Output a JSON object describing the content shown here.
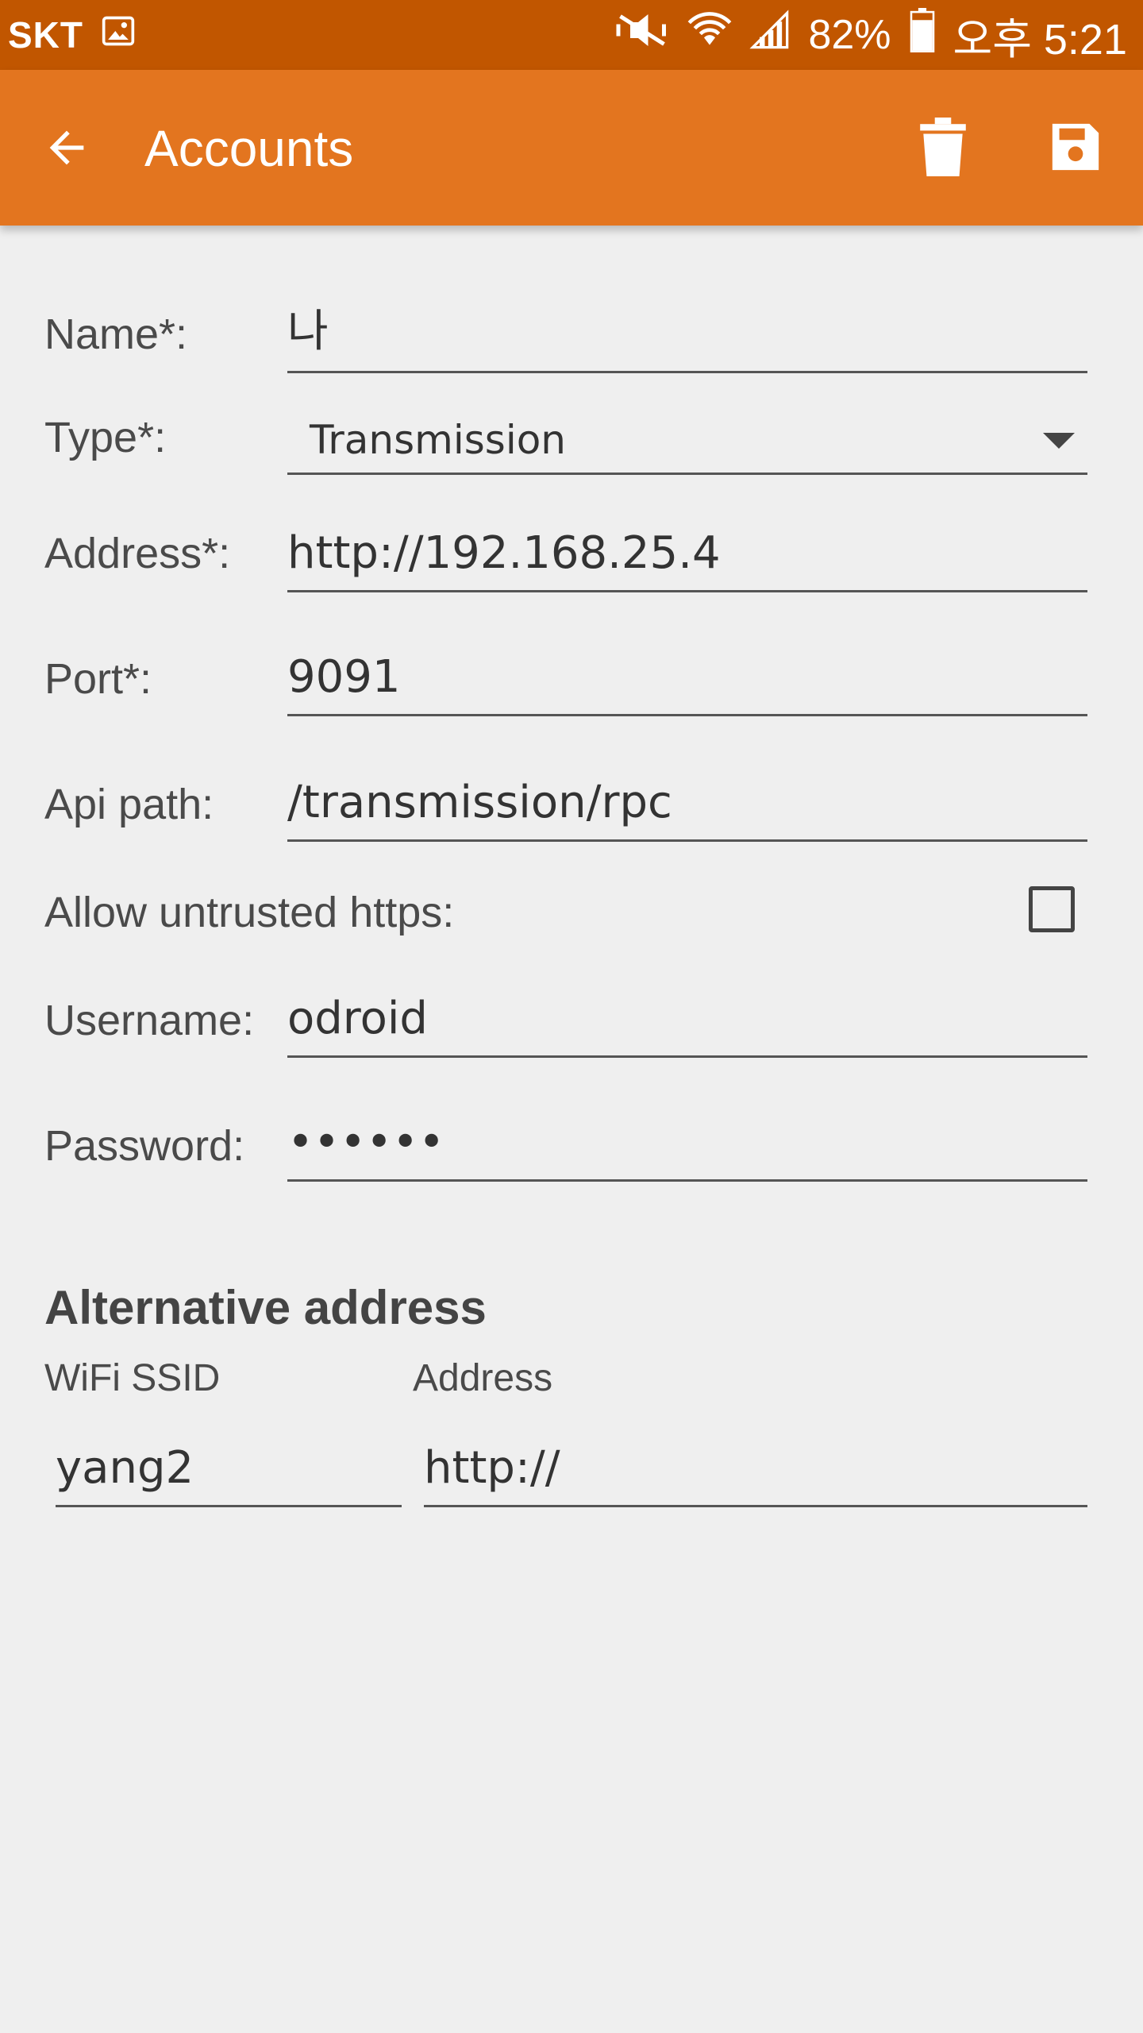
{
  "status_bar": {
    "carrier": "SKT",
    "battery": "82%",
    "time": "오후 5:21",
    "icons": [
      "image-icon",
      "mute-icon",
      "wifi-icon",
      "signal-icon",
      "battery-icon"
    ]
  },
  "app_bar": {
    "title": "Accounts",
    "back_icon": "arrow-back-icon",
    "delete_icon": "trash-icon",
    "save_icon": "floppy-disk-icon"
  },
  "colors": {
    "status_bar": "#c15600",
    "app_bar": "#e3751f",
    "background": "#efefef"
  },
  "form": {
    "name_label": "Name*:",
    "name_value": "나",
    "type_label": "Type*:",
    "type_value": "Transmission",
    "address_label": "Address*:",
    "address_value": "http://192.168.25.4",
    "port_label": "Port*:",
    "port_value": "9091",
    "api_path_label": "Api path:",
    "api_path_value": "/transmission/rpc",
    "untrusted_label": "Allow untrusted https:",
    "untrusted_checked": false,
    "username_label": "Username:",
    "username_value": "odroid",
    "password_label": "Password:",
    "password_value": "••••••"
  },
  "alternative": {
    "heading": "Alternative address",
    "ssid_label": "WiFi SSID",
    "address_label": "Address",
    "ssid_value": "yang2",
    "address_value": "http://"
  }
}
